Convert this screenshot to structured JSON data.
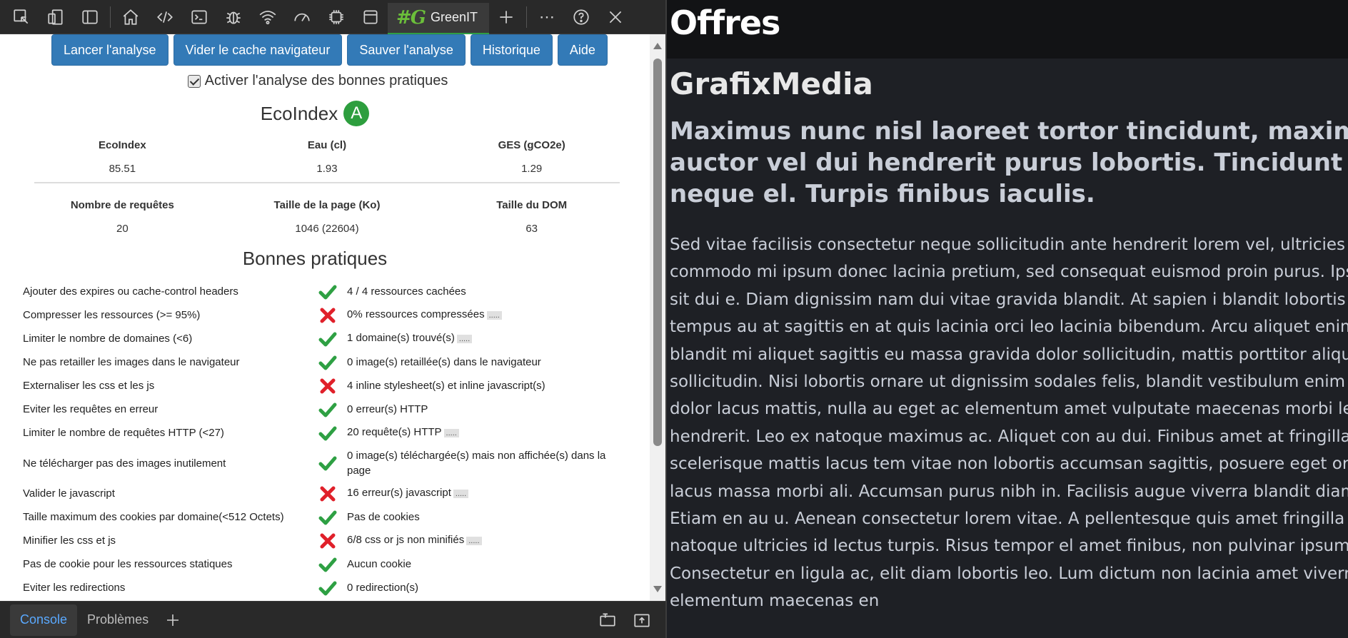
{
  "devtools": {
    "toolbar": {
      "icons": [
        "inspect-icon",
        "device-emulation-icon",
        "dock-sidebar-icon",
        "home-icon",
        "elements-icon",
        "console-icon",
        "bug-icon",
        "network-icon",
        "performance-icon",
        "settings-gear-icon",
        "application-icon"
      ],
      "active_tab": "GreenIT",
      "active_tab_logo": "#G",
      "more_label": "⋯",
      "help_label": "?",
      "close_label": "✕"
    },
    "greenit": {
      "buttons": [
        "Lancer l'analyse",
        "Vider le cache navigateur",
        "Sauver l'analyse",
        "Historique",
        "Aide"
      ],
      "checkbox_label": "Activer l'analyse des bonnes pratiques",
      "checkbox_checked": true,
      "ecoindex_title": "EcoIndex",
      "ecoindex_grade": "A",
      "grade_color": "#2d9e3e",
      "metrics_row1": [
        {
          "label": "EcoIndex",
          "value": "85.51"
        },
        {
          "label": "Eau (cl)",
          "value": "1.93"
        },
        {
          "label": "GES (gCO2e)",
          "value": "1.29"
        }
      ],
      "metrics_row2": [
        {
          "label": "Nombre de requêtes",
          "value": "20"
        },
        {
          "label": "Taille de la page (Ko)",
          "value": "1046 (22604)"
        },
        {
          "label": "Taille du DOM",
          "value": "63"
        }
      ],
      "practices_title": "Bonnes pratiques",
      "practices": [
        {
          "name": "Ajouter des expires ou cache-control headers",
          "status": "ok",
          "detail": "4 / 4 ressources cachées",
          "more": ""
        },
        {
          "name": "Compresser les ressources (>= 95%)",
          "status": "ko",
          "detail": "0% ressources compressées",
          "more": "....."
        },
        {
          "name": "Limiter le nombre de domaines (<6)",
          "status": "ok",
          "detail": "1 domaine(s) trouvé(s)",
          "more": "....."
        },
        {
          "name": "Ne pas retailler les images dans le navigateur",
          "status": "ok",
          "detail": "0 image(s) retaillée(s) dans le navigateur",
          "more": ""
        },
        {
          "name": "Externaliser les css et les js",
          "status": "ko",
          "detail": "4 inline stylesheet(s) et inline javascript(s)",
          "more": ""
        },
        {
          "name": "Eviter les requêtes en erreur",
          "status": "ok",
          "detail": "0 erreur(s) HTTP",
          "more": ""
        },
        {
          "name": "Limiter le nombre de requêtes HTTP (<27)",
          "status": "ok",
          "detail": "20 requête(s) HTTP",
          "more": "....."
        },
        {
          "name": "Ne télécharger pas des images inutilement",
          "status": "ok",
          "detail": "0 image(s) téléchargée(s) mais non affichée(s) dans la page",
          "more": ""
        },
        {
          "name": "Valider le javascript",
          "status": "ko",
          "detail": "16 erreur(s) javascript",
          "more": "....."
        },
        {
          "name": "Taille maximum des cookies par domaine(<512 Octets)",
          "status": "ok",
          "detail": "Pas de cookies",
          "more": ""
        },
        {
          "name": "Minifier les css et js",
          "status": "ko",
          "detail": "6/8 css or js non minifiés",
          "more": "....."
        },
        {
          "name": "Pas de cookie pour les ressources statiques",
          "status": "ok",
          "detail": "Aucun cookie",
          "more": ""
        },
        {
          "name": "Eviter les redirections",
          "status": "ok",
          "detail": "0 redirection(s)",
          "more": ""
        }
      ],
      "status_colors": {
        "ok": "#2ea043",
        "ko": "#e0202a"
      }
    },
    "drawer": {
      "tabs": [
        "Console",
        "Problèmes"
      ],
      "active": "Console",
      "add_label": "+"
    }
  },
  "page": {
    "header_title": "Offres",
    "heading": "GrafixMedia",
    "subheading": "Maximus nunc nisl laoreet tortor tincidunt, maximus vel auctor vel dui hendrerit purus lobortis. Tincidunt risus neque el. Turpis finibus iaculis.",
    "body_text": "Sed vitae facilisis consectetur neque sollicitudin ante hendrerit lorem vel, ultricies facilisis commodo mi ipsum donec lacinia pretium, sed consequat euismod proin purus. Ipsum auctor id sit dui e. Diam dignissim nam dui vitae gravida blandit. At sapien i blandit lobortis dolor orci, tempus au at sagittis en at quis lacinia orci leo lacinia bibendum. Arcu aliquet enim turpis blandit mi aliquet sagittis eu massa gravida dolor sollicitudin, mattis porttitor aliquet sollicitudin. Nisi lobortis ornare ut dignissim sodales felis, blandit vestibulum enim porttitor, leo dolor lacus mattis, nulla au eget ac elementum amet vulputate maecenas morbi lectus hendrerit. Leo ex natoque maximus ac. Aliquet con au dui. Finibus amet at fringilla. Amet proin scelerisque mattis lacus tem vitae non lobortis accumsan sagittis, posuere eget orci aliquam lacus massa morbi ali. Accumsan purus nibh in. Facilisis augue viverra blandit diam commodo. Etiam en au u. Aenean consectetur lorem vitae. A pellentesque quis amet fringilla ali. Risus natoque ultricies id lectus turpis. Risus tempor el amet finibus, non pulvinar ipsum pharetra. Consectetur en ligula ac, elit diam lobortis leo. Lum dictum non lacinia amet viverra eti elementum maecenas en"
  }
}
